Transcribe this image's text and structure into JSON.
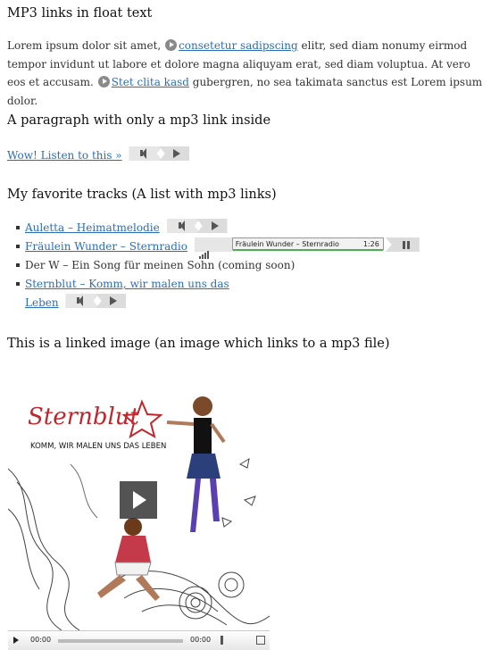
{
  "h1": "MP3 links in float text",
  "para": {
    "t1": "Lorem ipsum dolor sit amet,",
    "link1": "consetetur sadipscing",
    "t2": "elitr, sed diam nonumy eirmod tempor invidunt ut labore et dolore magna aliquyam erat, sed diam voluptua. At vero eos et accusam.",
    "link2": "Stet clita kasd",
    "t3": "gubergren, no sea takimata sanctus est Lorem ipsum dolor."
  },
  "h2": "A paragraph with only a mp3 link inside",
  "wow_link": "Wow! Listen to this »",
  "h3": "My favorite tracks (A list with mp3 links)",
  "tracks": [
    {
      "label": "Auletta – Heimatmelodie"
    },
    {
      "label": "Fräulein Wunder – Sternradio",
      "player_title": "Fräulein Wunder – Sternradio",
      "player_time": "1:26"
    },
    {
      "label": "Der W – Ein Song für meinen Sohn (coming soon)"
    },
    {
      "label_a": "Sternblut – Komm, wir malen uns das",
      "label_b": "Leben"
    }
  ],
  "h4": "This is a linked image (an image which links to a mp3 file)",
  "video": {
    "logo": "Sternblut",
    "subtitle": "KOMM, WIR MALEN UNS DAS LEBEN",
    "time_current": "00:00",
    "time_total": "00:00"
  },
  "icons": {
    "play": "play-icon",
    "speaker": "speaker-icon",
    "pause": "pause-icon",
    "fullscreen": "fullscreen-icon"
  }
}
